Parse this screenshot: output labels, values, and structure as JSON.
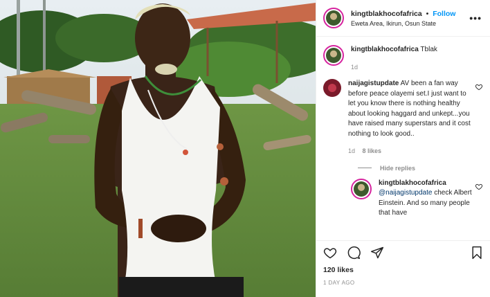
{
  "header": {
    "username": "kingtblakhocofafrica",
    "separator": "•",
    "follow_label": "Follow",
    "location": "Eweta Area, Ikirun, Osun State",
    "more_icon": "more-horizontal-icon"
  },
  "caption": {
    "username": "kingtblakhocofafrica",
    "text": "Tblak",
    "time": "1d"
  },
  "comments": [
    {
      "username": "naijagistupdate",
      "text": "AV been a fan way before peace olayemi set.I just want to let you know there is nothing healthy about looking haggard and unkept...you have raised many superstars and it cost nothing to look good..",
      "time": "1d",
      "likes": "8 likes",
      "avatar_color": "#7a1a2a"
    }
  ],
  "hide_replies_label": "Hide replies",
  "reply": {
    "username": "kingtblakhocofafrica",
    "mention": "@naijagistupdate",
    "text": " check Albert Einstein. And so many people that have"
  },
  "footer": {
    "likes": "120 likes",
    "posted": "1 DAY AGO",
    "icons": [
      "heart-icon",
      "comment-icon",
      "share-icon",
      "bookmark-icon"
    ]
  },
  "colors": {
    "follow": "#0095f6",
    "story_ring": "#d6249f",
    "muted": "#8e8e8e"
  }
}
